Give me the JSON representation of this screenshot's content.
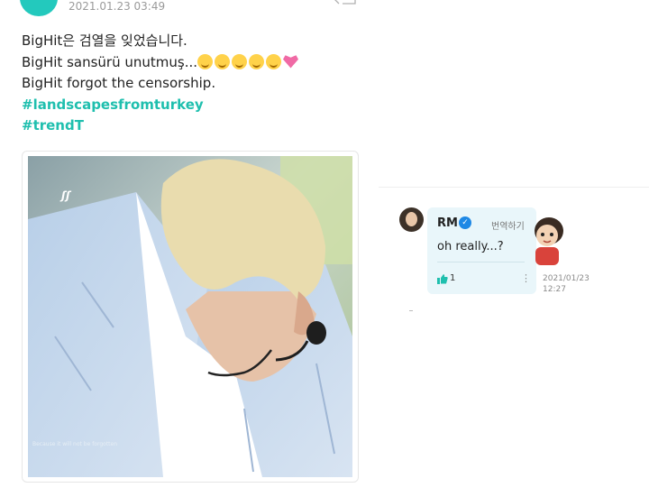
{
  "post": {
    "timestamp": "2021.01.23 03:49",
    "lines": [
      "BigHit은 검열을 잊었습니다.",
      "BigHit sansürü unutmuş...",
      "BigHit forgot the censorship."
    ],
    "hashtags": [
      "#landscapesfromturkey",
      "#trendT"
    ],
    "photo": {
      "watermark": "ʃʃ",
      "caption": "Because it will not be forgotten"
    }
  },
  "comment": {
    "author": "RM",
    "translate_label": "번역하기",
    "text": "oh really...?",
    "likes": "1",
    "more_label": "⋮",
    "date": "2021/01/23",
    "time": "12:27"
  },
  "icons": {
    "avatar": "avatar",
    "share": "share-icon",
    "verified": "verified-icon",
    "like": "like-icon",
    "more": "more-icon",
    "sticker": "character-sticker"
  },
  "colors": {
    "accent": "#1fbfae",
    "comment_bg": "#e9f6fa",
    "verified": "#1e88e5"
  }
}
